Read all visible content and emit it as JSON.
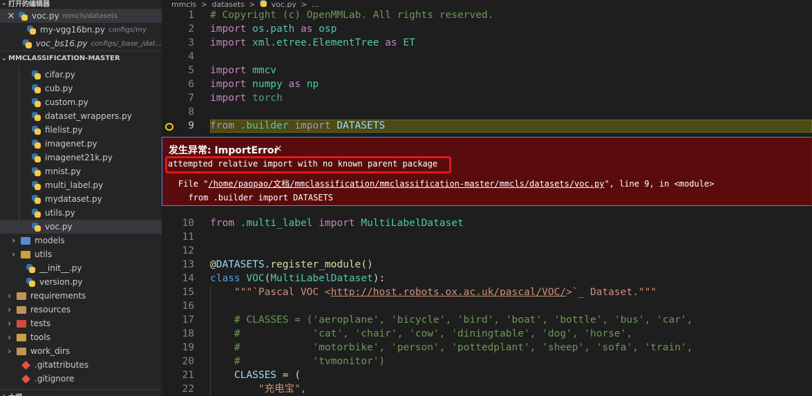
{
  "sidebar": {
    "open_editors_title": "打开的编辑器",
    "open_editors": [
      {
        "name": "voc.py",
        "desc": "mmcls/datasets",
        "close": "×"
      },
      {
        "name": "my-vgg16bn.py",
        "desc": "configs/my"
      },
      {
        "name": "voc_bs16.py",
        "desc": "configs/_base_/dat..."
      }
    ],
    "project_title": "MMCLASSIFICATION-MASTER",
    "files": [
      "cifar.py",
      "cub.py",
      "custom.py",
      "dataset_wrappers.py",
      "filelist.py",
      "imagenet.py",
      "imagenet21k.py",
      "mnist.py",
      "multi_label.py",
      "mydataset.py",
      "utils.py",
      "voc.py"
    ],
    "folders1": [
      "models",
      "utils"
    ],
    "files2": [
      "__init__.py",
      "version.py"
    ],
    "folders2": [
      "requirements",
      "resources",
      "tests",
      "tools",
      "work_dirs"
    ],
    "git_files": [
      ".gitattributes",
      ".gitignore"
    ],
    "outline_title": "大纲"
  },
  "breadcrumb": {
    "a": "mmcls",
    "sep": ">",
    "b": "datasets",
    "c": "voc.py",
    "d": "..."
  },
  "colors": {
    "accent": "#3794ff",
    "error_bg": "#5a0c0c",
    "highlight": "#e21a1a"
  },
  "code_lines_top": [
    {
      "n": "1",
      "t": [
        {
          "c": "cm",
          "v": "# Copyright (c) OpenMMLab. All rights reserved."
        }
      ]
    },
    {
      "n": "2",
      "t": [
        {
          "c": "kw",
          "v": "import "
        },
        {
          "c": "mod",
          "v": "os.path"
        },
        {
          "c": "kw",
          "v": " as "
        },
        {
          "c": "mod",
          "v": "osp"
        }
      ]
    },
    {
      "n": "3",
      "t": [
        {
          "c": "kw",
          "v": "import "
        },
        {
          "c": "mod",
          "v": "xml.etree.ElementTree"
        },
        {
          "c": "kw",
          "v": " as "
        },
        {
          "c": "mod",
          "v": "ET"
        }
      ]
    },
    {
      "n": "4",
      "t": []
    },
    {
      "n": "5",
      "t": [
        {
          "c": "kw",
          "v": "import "
        },
        {
          "c": "mod",
          "v": "mmcv"
        }
      ]
    },
    {
      "n": "6",
      "t": [
        {
          "c": "kw",
          "v": "import "
        },
        {
          "c": "mod",
          "v": "numpy"
        },
        {
          "c": "kw",
          "v": " as "
        },
        {
          "c": "mod",
          "v": "np"
        }
      ]
    },
    {
      "n": "7",
      "t": [
        {
          "c": "kw",
          "v": "import "
        },
        {
          "c": "mod2",
          "v": "torch"
        }
      ]
    },
    {
      "n": "8",
      "t": []
    },
    {
      "n": "9",
      "t": [
        {
          "c": "kw",
          "v": "from "
        },
        {
          "c": "mod",
          "v": ".builder"
        },
        {
          "c": "kw",
          "v": " import "
        },
        {
          "c": "var",
          "v": "DATASETS"
        }
      ]
    }
  ],
  "code_lines_bottom": [
    {
      "n": "10",
      "t": [
        {
          "c": "kw",
          "v": "from "
        },
        {
          "c": "mod",
          "v": ".multi_label"
        },
        {
          "c": "kw",
          "v": " import "
        },
        {
          "c": "cls",
          "v": "MultiLabelDataset"
        }
      ]
    },
    {
      "n": "11",
      "t": []
    },
    {
      "n": "12",
      "t": []
    },
    {
      "n": "13",
      "t": [
        {
          "c": "fn",
          "v": "@"
        },
        {
          "c": "var",
          "v": "DATASETS"
        },
        {
          "c": "",
          "v": "."
        },
        {
          "c": "fn",
          "v": "register_module"
        },
        {
          "c": "",
          "v": "()"
        }
      ]
    },
    {
      "n": "14",
      "t": [
        {
          "c": "cmk",
          "v": "class "
        },
        {
          "c": "cls",
          "v": "VOC"
        },
        {
          "c": "",
          "v": "("
        },
        {
          "c": "cls",
          "v": "MultiLabelDataset"
        },
        {
          "c": "",
          "v": "):"
        }
      ]
    },
    {
      "n": "15",
      "t": [
        {
          "c": "str",
          "v": "    \"\"\"`Pascal VOC <"
        },
        {
          "c": "url",
          "v": "http://host.robots.ox.ac.uk/pascal/VOC/"
        },
        {
          "c": "str",
          "v": ">`_ Dataset.\"\"\""
        }
      ]
    },
    {
      "n": "16",
      "t": []
    },
    {
      "n": "17",
      "t": [
        {
          "c": "cm",
          "v": "    # CLASSES = ('aeroplane', 'bicycle', 'bird', 'boat', 'bottle', 'bus', 'car',"
        }
      ]
    },
    {
      "n": "18",
      "t": [
        {
          "c": "cm",
          "v": "    #            'cat', 'chair', 'cow', 'diningtable', 'dog', 'horse',"
        }
      ]
    },
    {
      "n": "19",
      "t": [
        {
          "c": "cm",
          "v": "    #            'motorbike', 'person', 'pottedplant', 'sheep', 'sofa', 'train',"
        }
      ]
    },
    {
      "n": "20",
      "t": [
        {
          "c": "cm",
          "v": "    #            'tvmonitor')"
        }
      ]
    },
    {
      "n": "21",
      "t": [
        {
          "c": "",
          "v": "    "
        },
        {
          "c": "var",
          "v": "CLASSES"
        },
        {
          "c": "",
          "v": " = ("
        }
      ]
    },
    {
      "n": "22",
      "t": [
        {
          "c": "str",
          "v": "        \"充电宝\","
        }
      ]
    }
  ],
  "exception": {
    "title": "发生异常: ImportError",
    "close": "×",
    "message": "attempted relative import with no known parent package",
    "trace_prefix": "File \"",
    "trace_link": "/home/paopao/文档/mmclassification/mmclassification-master/mmcls/datasets/voc.py",
    "trace_suffix": "\", line 9, in <module>",
    "trace_line2": "  from .builder import DATASETS"
  }
}
